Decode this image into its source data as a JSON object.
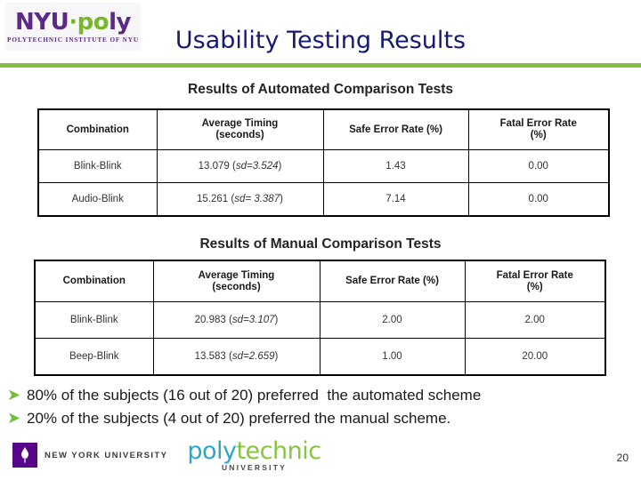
{
  "logo": {
    "nyu": "NYU",
    "dot": "·",
    "po": "po",
    "ly": "ly",
    "tagline": "POLYTECHNIC INSTITUTE OF NYU"
  },
  "slide": {
    "title": "Usability Testing Results",
    "title_color": "#151b6e",
    "rule_color": "#84bb42",
    "page_number": "20"
  },
  "sections": [
    {
      "heading": "Results of Automated Comparison Tests",
      "columns": [
        "Combination",
        "Average Timing\n(seconds)",
        "Safe Error Rate (%)",
        "Fatal Error Rate\n(%)"
      ],
      "column_labels": {
        "combination": "Combination",
        "timing_line1": "Average Timing",
        "timing_line2": "(seconds)",
        "safe": "Safe Error Rate (%)",
        "fatal_line1": "Fatal Error Rate",
        "fatal_line2": "(%)"
      },
      "rows": [
        {
          "combination": "Blink-Blink",
          "timing_mean": "13.079",
          "timing_sd_label": "sd",
          "timing_sd_rest": "=3.524",
          "safe_error_rate": "1.43",
          "fatal_error_rate": "0.00"
        },
        {
          "combination": "Audio-Blink",
          "timing_mean": "15.261",
          "timing_sd_label": "sd",
          "timing_sd_rest": "= 3.387",
          "safe_error_rate": "7.14",
          "fatal_error_rate": "0.00"
        }
      ]
    },
    {
      "heading": "Results of Manual Comparison Tests",
      "columns": [
        "Combination",
        "Average Timing\n(seconds)",
        "Safe Error Rate (%)",
        "Fatal Error Rate\n(%)"
      ],
      "column_labels": {
        "combination": "Combination",
        "timing_line1": "Average Timing",
        "timing_line2": "(seconds)",
        "safe": "Safe Error Rate (%)",
        "fatal_line1": "Fatal Error Rate",
        "fatal_line2": "(%)"
      },
      "rows": [
        {
          "combination": "Blink-Blink",
          "timing_mean": "20.983",
          "timing_sd_label": "sd",
          "timing_sd_rest": "=3.107",
          "safe_error_rate": "2.00",
          "fatal_error_rate": "2.00"
        },
        {
          "combination": "Beep-Blink",
          "timing_mean": "13.583",
          "timing_sd_label": "sd",
          "timing_sd_rest": "=2.659",
          "safe_error_rate": "1.00",
          "fatal_error_rate": "20.00"
        }
      ]
    }
  ],
  "bullets": {
    "marker": "➤",
    "marker_color": "#6fbf3a",
    "items": [
      "80% of the subjects (16 out of 20) preferred  the automated scheme",
      "20% of the subjects (4 out of 20) preferred the manual scheme."
    ]
  },
  "footer": {
    "nyu_name": "NEW YORK UNIVERSITY",
    "poly_blue": "poly",
    "poly_green": "technic",
    "poly_sub": "UNIVERSITY"
  }
}
